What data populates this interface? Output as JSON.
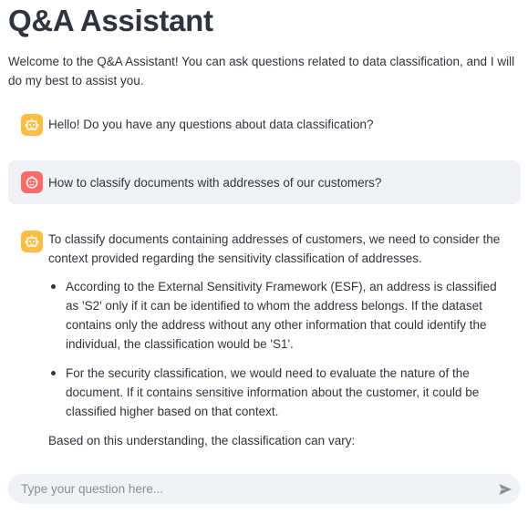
{
  "header": {
    "title": "Q&A Assistant",
    "intro": "Welcome to the Q&A Assistant! You can ask questions related to data classification, and I will do my best to assist you."
  },
  "messages": [
    {
      "role": "assistant",
      "avatar_icon": "robot-icon",
      "text": "Hello! Do you have any questions about data classification?"
    },
    {
      "role": "user",
      "avatar_icon": "smiley-face-icon",
      "text": "How to classify documents with addresses of our customers?"
    },
    {
      "role": "assistant",
      "avatar_icon": "robot-icon",
      "intro": "To classify documents containing addresses of customers, we need to consider the context provided regarding the sensitivity classification of addresses.",
      "bullets": [
        "According to the External Sensitivity Framework (ESF), an address is classified as 'S2' only if it can be identified to whom the address belongs. If the dataset contains only the address without any other information that could identify the individual, the classification would be 'S1'.",
        "For the security classification, we would need to evaluate the nature of the document. If it contains sensitive information about the customer, it could be classified higher based on that context."
      ],
      "closing": "Based on this understanding, the classification can vary:"
    }
  ],
  "chat_input": {
    "placeholder": "Type your question here...",
    "value": "",
    "send_icon": "send-icon"
  },
  "colors": {
    "assistant_avatar": "#ffbd45",
    "user_avatar": "#ff6c6c",
    "user_bubble": "#f0f2f6",
    "text": "#31333f"
  }
}
